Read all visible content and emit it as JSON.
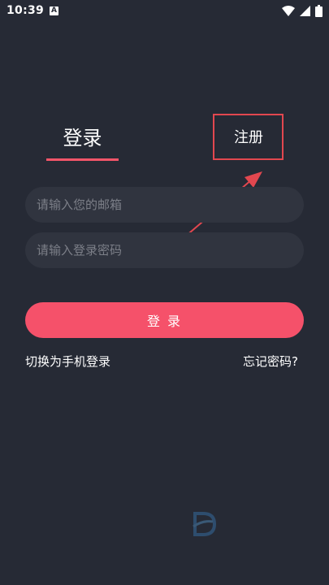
{
  "status_bar": {
    "time": "10:39",
    "notification_badge": "A",
    "icons": [
      "wifi-icon",
      "signal-icon",
      "battery-icon"
    ]
  },
  "tabs": {
    "login": "登录",
    "register": "注册",
    "active": "login"
  },
  "form": {
    "email_placeholder": "请输入您的邮箱",
    "password_placeholder": "请输入登录密码",
    "submit_label": "登 录"
  },
  "links": {
    "switch_phone": "切换为手机登录",
    "forgot": "忘记密码?"
  },
  "colors": {
    "background": "#262a35",
    "accent": "#f45569",
    "input_background": "#30343f",
    "placeholder": "#7c7f88",
    "annotation": "#e2474f"
  }
}
